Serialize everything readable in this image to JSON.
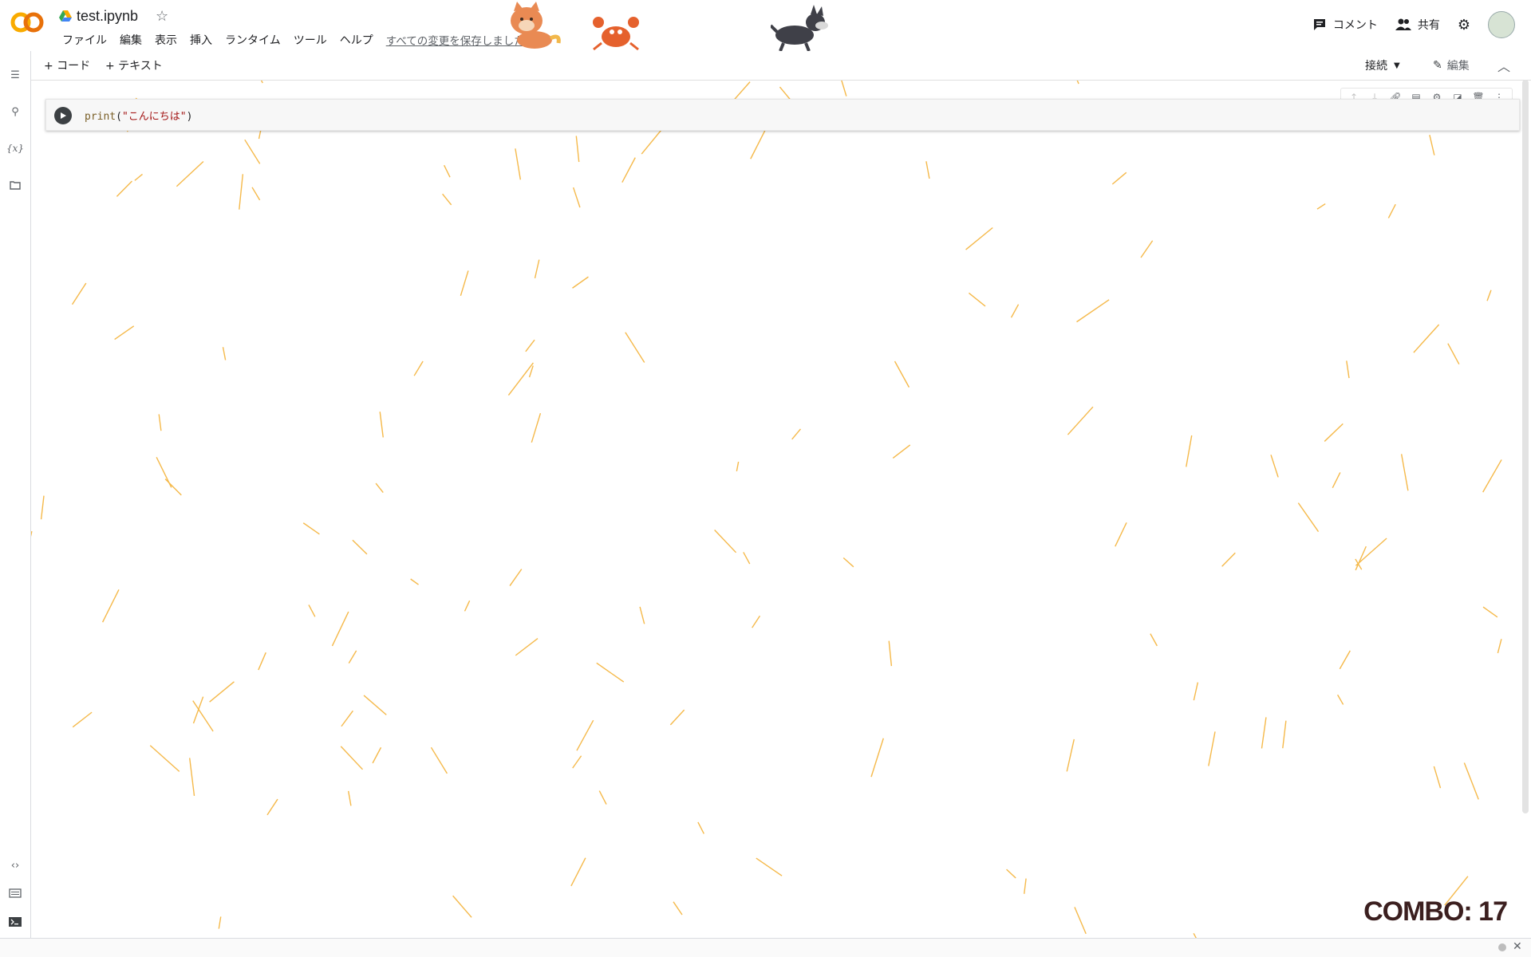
{
  "header": {
    "doc_title": "test.ipynb",
    "menu": [
      "ファイル",
      "編集",
      "表示",
      "挿入",
      "ランタイム",
      "ツール",
      "ヘルプ"
    ],
    "save_status": "すべての変更を保存しました",
    "comment_label": "コメント",
    "share_label": "共有"
  },
  "toolbar": {
    "add_code": "+ コード",
    "add_text": "+ テキスト",
    "connect": "接続",
    "edit": "編集"
  },
  "cell": {
    "code_fn": "print",
    "code_open": "(",
    "code_str": "\"こんにちは\"",
    "code_close": ")"
  },
  "sidebar": {
    "icons": [
      "toc-icon",
      "search-icon",
      "variables-icon",
      "folder-icon",
      "code-snippets-icon",
      "command-palette-icon",
      "terminal-icon"
    ],
    "variables_glyph": "{x}"
  },
  "combo": {
    "text": "COMBO: 17"
  },
  "colors": {
    "rain": "#f5b94a",
    "accent": "#f9ab00",
    "text": "#202124"
  }
}
